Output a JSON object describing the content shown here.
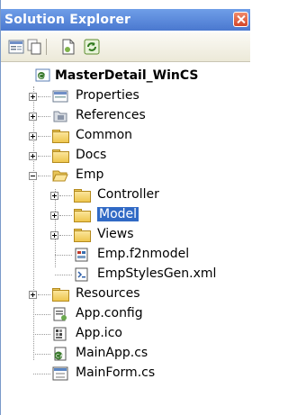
{
  "window": {
    "title": "Solution Explorer"
  },
  "toolbar": {
    "buttons": [
      "properties-icon",
      "show-all-files-icon",
      "refresh-icon"
    ]
  },
  "tree": {
    "project": "MasterDetail_WinCS",
    "items": [
      {
        "label": "Properties",
        "icon": "properties-icon"
      },
      {
        "label": "References",
        "icon": "references-icon"
      },
      {
        "label": "Common",
        "icon": "folder-icon"
      },
      {
        "label": "Docs",
        "icon": "folder-icon"
      },
      {
        "label": "Emp",
        "icon": "folder-open-icon"
      },
      {
        "label": "Controller",
        "icon": "folder-icon"
      },
      {
        "label": "Model",
        "icon": "folder-icon"
      },
      {
        "label": "Views",
        "icon": "folder-icon"
      },
      {
        "label": "Emp.f2nmodel",
        "icon": "model-file-icon"
      },
      {
        "label": "EmpStylesGen.xml",
        "icon": "xml-file-icon"
      },
      {
        "label": "Resources",
        "icon": "folder-icon"
      },
      {
        "label": "App.config",
        "icon": "config-file-icon"
      },
      {
        "label": "App.ico",
        "icon": "ico-file-icon"
      },
      {
        "label": "MainApp.cs",
        "icon": "cs-file-icon"
      },
      {
        "label": "MainForm.cs",
        "icon": "form-file-icon"
      }
    ]
  }
}
